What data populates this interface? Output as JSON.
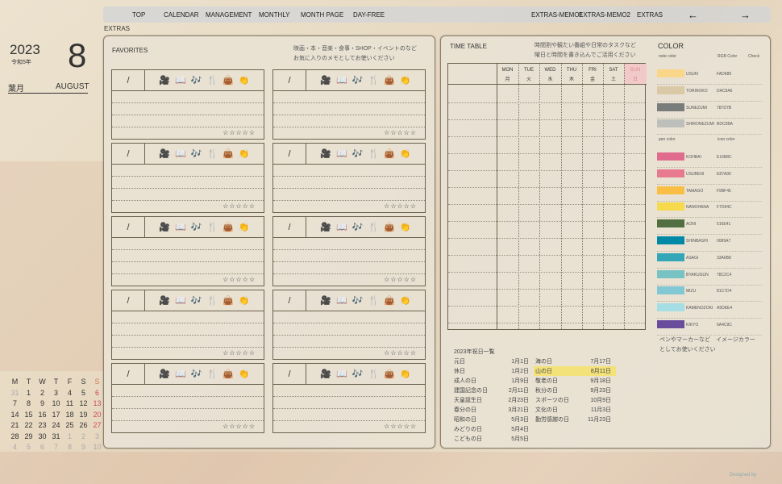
{
  "nav": {
    "items": [
      "TOP",
      "CALENDAR",
      "MANAGEMENT",
      "MONTHLY",
      "MONTH PAGE",
      "DAY-FREE",
      "EXTRAS-MEMO1",
      "EXTRAS-MEMO2",
      "EXTRAS"
    ],
    "prev": "←",
    "next": "→"
  },
  "section_label": "EXTRAS",
  "date": {
    "year": "2023",
    "era": "令和5年",
    "month_num": "8",
    "month_jp": "葉月",
    "month_en": "AUGUST"
  },
  "mini_calendar": {
    "headers": [
      "M",
      "T",
      "W",
      "T",
      "F",
      "S",
      "S"
    ],
    "weeks": [
      [
        "31",
        "1",
        "2",
        "3",
        "4",
        "5",
        "6"
      ],
      [
        "7",
        "8",
        "9",
        "10",
        "11",
        "12",
        "13"
      ],
      [
        "14",
        "15",
        "16",
        "17",
        "18",
        "19",
        "20"
      ],
      [
        "21",
        "22",
        "23",
        "24",
        "25",
        "26",
        "27"
      ],
      [
        "28",
        "29",
        "30",
        "31",
        "1",
        "2",
        "3"
      ],
      [
        "4",
        "5",
        "6",
        "7",
        "8",
        "9",
        "10"
      ]
    ]
  },
  "favorites": {
    "title": "FAVORITES",
    "note1": "映画・本・音楽・食事・SHOP・イベントのなど",
    "note2": "お気に入りのメモとしてお使いください",
    "slash": "/",
    "icons": [
      "🎥",
      "📖",
      "🎶",
      "🍴",
      "👜",
      "👏"
    ],
    "stars": "☆☆☆☆☆"
  },
  "timetable": {
    "title": "TIME TABLE",
    "note1": "時間割や観たい番組や日常のタスクなど",
    "note2": "曜日と時間を書き込んでご活用ください",
    "days": [
      {
        "en": "MON",
        "jp": "月"
      },
      {
        "en": "TUE",
        "jp": "火"
      },
      {
        "en": "WED",
        "jp": "水"
      },
      {
        "en": "THU",
        "jp": "木"
      },
      {
        "en": "FRI",
        "jp": "金"
      },
      {
        "en": "SAT",
        "jp": "土"
      },
      {
        "en": "SUN",
        "jp": "日"
      }
    ]
  },
  "holidays": {
    "title": "2023年祝日一覧",
    "items": [
      [
        "元日",
        "1月1日"
      ],
      [
        "休日",
        "1月2日"
      ],
      [
        "成人の日",
        "1月9日"
      ],
      [
        "建国記念の日",
        "2月11日"
      ],
      [
        "天皇誕生日",
        "2月23日"
      ],
      [
        "春分の日",
        "3月21日"
      ],
      [
        "昭和の日",
        "5月3日"
      ],
      [
        "みどりの日",
        "5月4日"
      ],
      [
        "こどもの日",
        "5月5日"
      ],
      [
        "海の日",
        "7月17日"
      ],
      [
        "山の日",
        "8月11日"
      ],
      [
        "敬老の日",
        "9月18日"
      ],
      [
        "秋分の日",
        "9月23日"
      ],
      [
        "スポーツの日",
        "10月9日"
      ],
      [
        "文化の日",
        "11月3日"
      ],
      [
        "勤労感謝の日",
        "11月23日"
      ]
    ],
    "highlight_color": "#f3e27a"
  },
  "color": {
    "title": "COLOR",
    "note_color": "note color",
    "rgb_label": "RGB Color",
    "check_label": "Check",
    "pen_color": "pen color",
    "icon_color": "icon color",
    "notes": [
      {
        "name": "USUKI",
        "hex": "FAD689"
      },
      {
        "name": "TORINOKO",
        "hex": "DAC9A6"
      },
      {
        "name": "SUNEZUMI",
        "hex": "787D7B"
      },
      {
        "name": "SHIRONEZUMI",
        "hex": "BDC0BA"
      }
    ],
    "pens": [
      {
        "name": "KOHBAI",
        "hex": "E16B8C"
      },
      {
        "name": "USUBENI",
        "hex": "E87A90"
      },
      {
        "name": "TAMAGO",
        "hex": "F9BF45"
      },
      {
        "name": "NANOHANA",
        "hex": "F7D94C"
      },
      {
        "name": "AONI",
        "hex": "516E41"
      },
      {
        "name": "SHINBASHI",
        "hex": "0089A7"
      },
      {
        "name": "ASAGI",
        "hex": "33A6B8"
      },
      {
        "name": "BYAKUGUN",
        "hex": "78C2C4"
      },
      {
        "name": "MIZU",
        "hex": "81C7D4"
      },
      {
        "name": "KAMENOZOKI",
        "hex": "A5DEE4"
      },
      {
        "name": "KIKYO",
        "hex": "6A4C9C"
      }
    ],
    "footer1": "ペンやマーカーなど　イメージカラー",
    "footer2": "としてお使いください"
  },
  "credit": "Designed by"
}
